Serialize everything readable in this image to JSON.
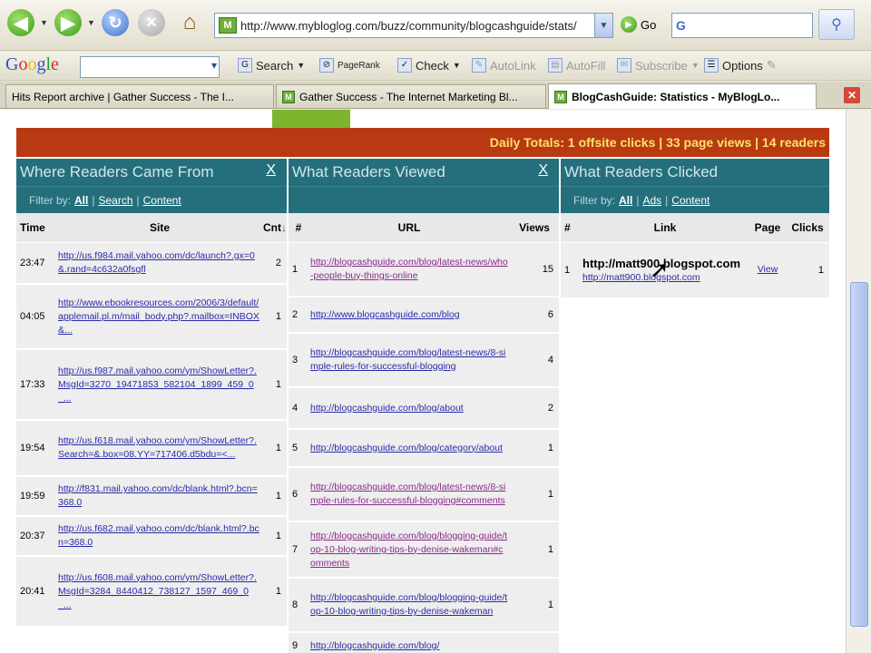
{
  "browser": {
    "address_url": "http://www.mybloglog.com/buzz/community/blogcashguide/stats/",
    "address_favicon": "M",
    "go_label": "Go",
    "search_box_glyph": "G",
    "back_glyph": "◀",
    "forward_glyph": "▶",
    "refresh_glyph": "↻",
    "stop_glyph": "✕",
    "home_glyph": "⌂"
  },
  "google_toolbar": {
    "logo_letters": [
      "G",
      "o",
      "o",
      "g",
      "l",
      "e"
    ],
    "search_label": "Search",
    "pagerank_label": "PageRank",
    "check_label": "Check",
    "autolink_label": "AutoLink",
    "autofill_label": "AutoFill",
    "subscribe_label": "Subscribe",
    "options_label": "Options"
  },
  "tabs": [
    {
      "label": "Hits Report archive | Gather Success - The I...",
      "favicon": "",
      "active": false
    },
    {
      "label": "Gather Success - The Internet Marketing Bl...",
      "favicon": "M",
      "active": false
    },
    {
      "label": "BlogCashGuide: Statistics - MyBlogLo...",
      "favicon": "M",
      "active": true
    }
  ],
  "banner_text": "Daily Totals: 1 offsite clicks | 33 page views | 14 readers",
  "panels": {
    "came_from": {
      "title": "Where Readers Came From",
      "close": "X",
      "filter_label": "Filter by:",
      "filters": [
        "All",
        "Search",
        "Content"
      ],
      "headers": [
        "Time",
        "Site",
        "Cnt"
      ],
      "rows": [
        {
          "time": "23:47",
          "site": "http://us.f984.mail.yahoo.com/dc/launch?.gx=0&.rand=4c632a0fsgfl",
          "cnt": "2"
        },
        {
          "time": "04:05",
          "site": "http://www.ebookresources.com/2006/3/default/applemail.pl.m/mail_body.php?.mailbox=INBOX&...",
          "cnt": "1"
        },
        {
          "time": "17:33",
          "site": "http://us.f987.mail.yahoo.com/ym/ShowLetter?.MsgId=3270_19471853_582104_1899_459_0_...",
          "cnt": "1"
        },
        {
          "time": "19:54",
          "site": "http://us.f618.mail.yahoo.com/ym/ShowLetter?.Search=&.box=08.YY=717406.d5bdu=<...",
          "cnt": "1"
        },
        {
          "time": "19:59",
          "site": "http://f831.mail.yahoo.com/dc/blank.html?.bcn=368.0",
          "cnt": "1"
        },
        {
          "time": "20:37",
          "site": "http://us.f682.mail.yahoo.com/dc/blank.html?.bcn=368.0",
          "cnt": "1"
        },
        {
          "time": "20:41",
          "site": "http://us.f608.mail.yahoo.com/ym/ShowLetter?.MsgId=3284_8440412_738127_1597_469_0_...",
          "cnt": "1"
        }
      ]
    },
    "viewed": {
      "title": "What Readers Viewed",
      "close": "X",
      "headers": [
        "#",
        "URL",
        "Views"
      ],
      "rows": [
        {
          "num": "1",
          "url": "http://blogcashguide.com/blog/latest-news/who-people-buy-things-online",
          "views": "15",
          "visited": true
        },
        {
          "num": "2",
          "url": "http://www.blogcashguide.com/blog",
          "views": "6",
          "visited": false
        },
        {
          "num": "3",
          "url": "http://blogcashguide.com/blog/latest-news/8-simple-rules-for-successful-blogging",
          "views": "4",
          "visited": false
        },
        {
          "num": "4",
          "url": "http://blogcashguide.com/blog/about",
          "views": "2",
          "visited": false
        },
        {
          "num": "5",
          "url": "http://blogcashguide.com/blog/category/about",
          "views": "1",
          "visited": false
        },
        {
          "num": "6",
          "url": "http://blogcashguide.com/blog/latest-news/8-simple-rules-for-successful-blogging#comments",
          "views": "1",
          "visited": true
        },
        {
          "num": "7",
          "url": "http://blogcashguide.com/blog/blogging-guide/top-10-blog-writing-tips-by-denise-wakeman#comments",
          "views": "1",
          "visited": true
        },
        {
          "num": "8",
          "url": "http://blogcashguide.com/blog/blogging-guide/top-10-blog-writing-tips-by-denise-wakeman",
          "views": "1",
          "visited": false
        },
        {
          "num": "9",
          "url": "http://blogcashguide.com/blog/",
          "views": "",
          "visited": false
        }
      ]
    },
    "clicked": {
      "title": "What Readers Clicked",
      "filter_label": "Filter by:",
      "filters": [
        "All",
        "Ads",
        "Content"
      ],
      "headers": [
        "#",
        "Link",
        "Page",
        "Clicks"
      ],
      "rows": [
        {
          "num": "1",
          "title": "http://matt900.blogspot.com",
          "url": "http://matt900.blogspot.com",
          "page": "View",
          "clicks": "1"
        }
      ]
    }
  },
  "colors": {
    "banner_bg": "#b93a12",
    "banner_text": "#fce16b",
    "panel_header": "#256f7c",
    "link": "#2a2aa8",
    "visited_link": "#8a2b8a"
  }
}
